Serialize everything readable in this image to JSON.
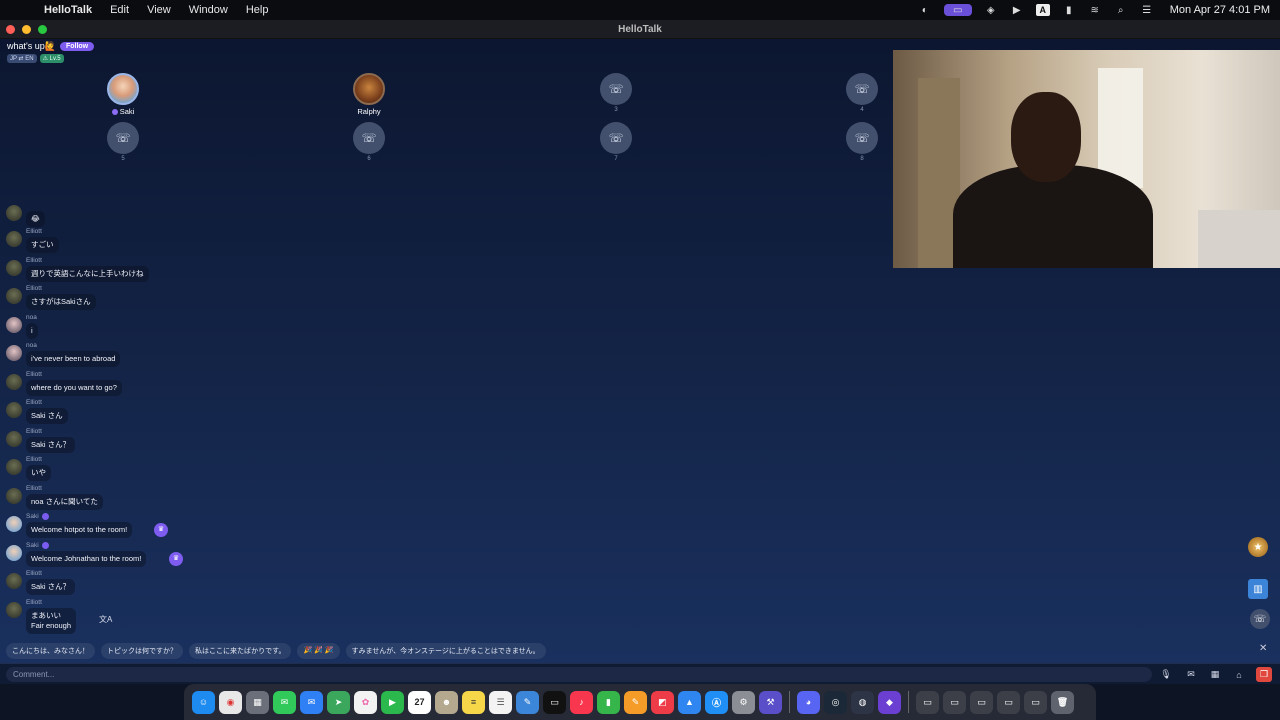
{
  "menubar": {
    "app_name": "HelloTalk",
    "menus": [
      "Edit",
      "View",
      "Window",
      "Help"
    ],
    "clock": "Mon Apr 27  4:01 PM",
    "status_letter": "A"
  },
  "window": {
    "title": "HelloTalk"
  },
  "room": {
    "title": "what's up🙋",
    "follow_label": "Follow",
    "tags": [
      "JP ⇄ EN",
      "⚠ Lv.5"
    ]
  },
  "seats": [
    {
      "name": "Saki",
      "num": ""
    },
    {
      "name": "Ralphy",
      "num": ""
    },
    {
      "name": "",
      "num": "3"
    },
    {
      "name": "",
      "num": "4"
    },
    {
      "name": "",
      "num": "5"
    },
    {
      "name": "",
      "num": "6"
    },
    {
      "name": "",
      "num": "7"
    },
    {
      "name": "",
      "num": "8"
    }
  ],
  "video": {
    "close_label": "×"
  },
  "chat": {
    "messages": [
      {
        "user": "",
        "text": "😂"
      },
      {
        "user": "Elliott",
        "text": "すごい"
      },
      {
        "user": "Elliott",
        "text": "週りで英語こんなに上手いわけね"
      },
      {
        "user": "Elliott",
        "text": "さすがはSakiさん"
      },
      {
        "user": "noa",
        "text": "i"
      },
      {
        "user": "noa",
        "text": "i've never been to abroad"
      },
      {
        "user": "Elliott",
        "text": "where do you want to go?"
      },
      {
        "user": "Elliott",
        "text": "Saki さん"
      },
      {
        "user": "Elliott",
        "text": "Saki さん？"
      },
      {
        "user": "Elliott",
        "text": "いや"
      },
      {
        "user": "Elliott",
        "text": "noa さんに聞いてた"
      },
      {
        "user": "Saki",
        "text": "Welcome hotpot to the room!"
      },
      {
        "user": "Saki",
        "text": "Welcome Johnathan to the room!"
      },
      {
        "user": "Elliott",
        "text": "Saki さん？"
      },
      {
        "user": "Elliott",
        "text": "まあいい",
        "translation": "Fair enough"
      }
    ]
  },
  "quick_phrases": [
    "こんにちは、みなさん！",
    "トピックは何ですか？",
    "私はここに来たばかりです。",
    "🎉 🎉 🎉",
    "すみませんが、今オンステージに上がることはできません。"
  ],
  "comment": {
    "placeholder": "Comment..."
  },
  "icons": {
    "seat_phone": "☏",
    "mic": "🎙",
    "gift": "♛",
    "translate": "文A",
    "close": "✕"
  },
  "dock": {
    "calendar_day": "27"
  },
  "colors": {
    "accent": "#7e5cf0",
    "background_top": "#0c1630",
    "background_bottom": "#1a3160"
  }
}
